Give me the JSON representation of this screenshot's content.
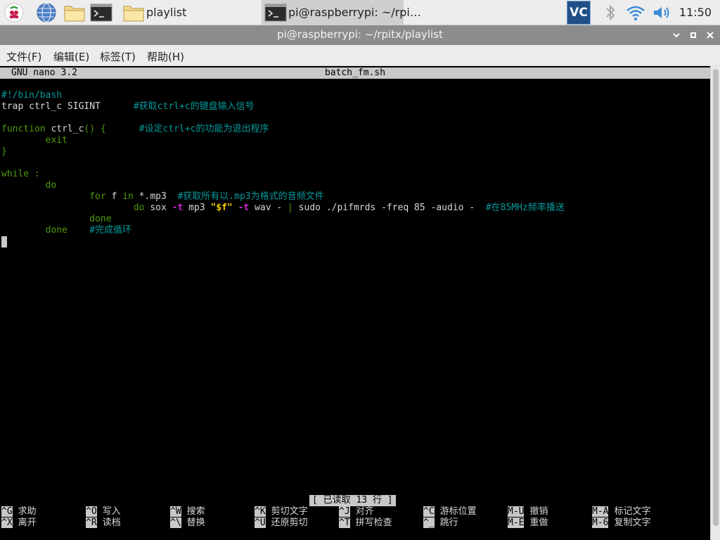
{
  "taskbar": {
    "icons": {
      "menu": "raspberry-icon",
      "browser": "globe-icon",
      "files": "folder-icon",
      "terminal": "terminal-icon"
    },
    "tasks": [
      {
        "label": "playlist"
      },
      {
        "label": "pi@raspberrypi: ~/rpi…"
      }
    ],
    "tray": {
      "vnc": "VC",
      "clock": "11:50"
    }
  },
  "window": {
    "title": "pi@raspberrypi: ~/rpitx/playlist",
    "menu": [
      "文件(F)",
      "编辑(E)",
      "标签(T)",
      "帮助(H)"
    ]
  },
  "nano": {
    "version": "GNU nano 3.2",
    "filename": "batch_fm.sh",
    "status": "[ 已读取 13 行 ]",
    "shortcuts_row1": [
      {
        "key": "^G",
        "label": "求助"
      },
      {
        "key": "^O",
        "label": "写入"
      },
      {
        "key": "^W",
        "label": "搜索"
      },
      {
        "key": "^K",
        "label": "剪切文字"
      },
      {
        "key": "^J",
        "label": "对齐"
      },
      {
        "key": "^C",
        "label": "游标位置"
      },
      {
        "key": "M-U",
        "label": "撤销"
      },
      {
        "key": "M-A",
        "label": "标记文字"
      }
    ],
    "shortcuts_row2": [
      {
        "key": "^X",
        "label": "离开"
      },
      {
        "key": "^R",
        "label": "读档"
      },
      {
        "key": "^\\",
        "label": "替换"
      },
      {
        "key": "^U",
        "label": "还原剪切"
      },
      {
        "key": "^T",
        "label": "拼写检查"
      },
      {
        "key": "^_",
        "label": "跳行"
      },
      {
        "key": "M-E",
        "label": "重做"
      },
      {
        "key": "M-6",
        "label": "复制文字"
      }
    ]
  },
  "code": {
    "l1": "#!/bin/bash",
    "l2a": "trap ctrl_c SIGINT      ",
    "l2b": "#获取ctrl+c的键盘输入信号",
    "l3a": "function",
    "l3b": " ctrl_c",
    "l3c": "() {      ",
    "l3d": "#设定ctrl+c的功能为退出程序",
    "l4": "        exit",
    "l5": "}",
    "l6": "while :",
    "l7": "        do",
    "l8a": "                for",
    "l8b": " f ",
    "l8c": "in",
    "l8d": " *.mp3  ",
    "l8e": "#获取所有以.mp3为格式的音频文件",
    "l9a": "                        do",
    "l9b": " sox ",
    "l9c": "-t",
    "l9d": " mp3 ",
    "l9e": "\"$f\"",
    "l9f": " ",
    "l9g": "-t",
    "l9h": " wav - ",
    "l9i": "|",
    "l9j": " sudo ./pifmrds -freq 85 -audio -  ",
    "l9k": "#在85MHz频率播送",
    "l10": "                done",
    "l11a": "        done    ",
    "l11b": "#完成循环"
  }
}
